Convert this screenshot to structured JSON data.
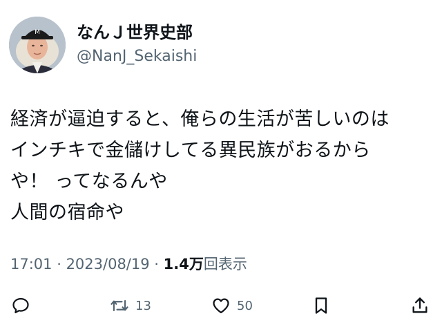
{
  "user": {
    "display_name": "なんＪ世界史部",
    "handle": "@NanJ_Sekaishi",
    "avatar_icon": "portrait-avatar-icon"
  },
  "tweet": {
    "lines": [
      "経済が逼迫すると、俺らの生活が苦しいのは",
      "インチキで金儲けしてる異民族がおるから",
      "や！ ってなるんや",
      "人間の宿命や"
    ]
  },
  "meta": {
    "time": "17:01",
    "separator": " · ",
    "date": "2023/08/19",
    "views_count": "1.4万",
    "views_label": "回表示"
  },
  "actions": {
    "reply": {
      "icon": "reply-icon",
      "count": ""
    },
    "retweet": {
      "icon": "retweet-icon",
      "count": "13"
    },
    "like": {
      "icon": "heart-icon",
      "count": "50"
    },
    "bookmark": {
      "icon": "bookmark-icon",
      "count": ""
    },
    "share": {
      "icon": "share-icon",
      "count": ""
    }
  },
  "colors": {
    "text_primary": "#0f1419",
    "text_secondary": "#536471",
    "background": "#ffffff"
  }
}
